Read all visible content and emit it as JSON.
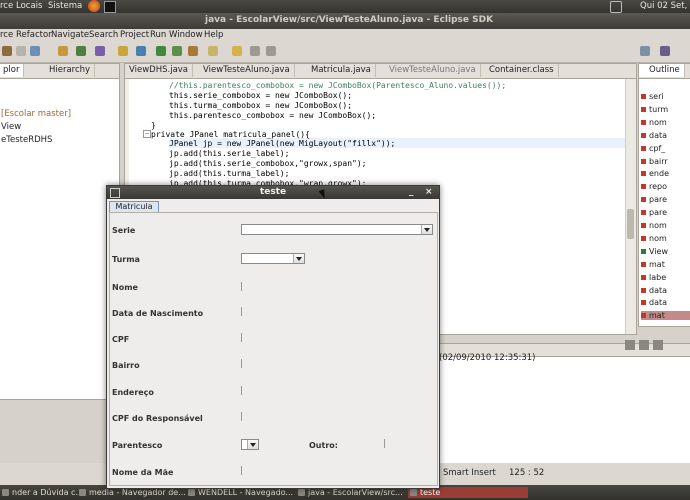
{
  "top_panel": {
    "menu_1": "rce",
    "menu_2": "Locais",
    "menu_3": "Sistema",
    "clock": "Qui 02 Set,"
  },
  "window": {
    "title": "java - EscolarView/src/ViewTesteAluno.java - Eclipse SDK"
  },
  "menu": {
    "items": [
      "rce",
      "Refactor",
      "Navigate",
      "Search",
      "Project",
      "Run",
      "Window",
      "Help"
    ]
  },
  "explorer": {
    "tabs": [
      "plor",
      "Hierarchy"
    ],
    "items": [
      "[Escolar master]",
      "View",
      "eTesteRDHS"
    ]
  },
  "editor": {
    "tabs": [
      "ViewDHS.java",
      "ViewTesteAluno.java",
      "Matricula.java",
      "ViewTesteAluno.java",
      "Container.class"
    ],
    "code_lines": [
      "//this.parentesco_combobox = new JComboBox(Parentesco_Aluno.values());",
      "this.serie_combobox = new JComboBox();",
      "this.turma_combobox = new JComboBox();",
      "this.parentesco_combobox = new JComboBox();",
      "}",
      "private JPanel matricula_panel(){",
      "JPanel jp = new JPanel(new MigLayout(\"fillx\"));",
      "jp.add(this.serie_label);",
      "jp.add(this.serie_combobox,\"growx,span\");",
      "jp.add(this.turma_label);",
      "jp.add(this.turma_combobox,\"wrap,growx\");"
    ]
  },
  "outline": {
    "tab": "Outline",
    "items": [
      "seri",
      "turm",
      "nom",
      "data",
      "cpf_",
      "bairr",
      "ende",
      "repo",
      "pare",
      "pare",
      "nom",
      "nom",
      "View",
      "mat",
      "labe",
      "data",
      "data",
      "mat"
    ]
  },
  "console": {
    "timestamp": "(02/09/2010 12:35:31)"
  },
  "status_bar": {
    "insert_mode": "Smart Insert",
    "position": "125 : 52"
  },
  "taskbar": {
    "items": [
      "nder a Dúvida c...",
      "media - Navegador de...",
      "WENDELL - Navegado...",
      "java - EscolarView/src...",
      "teste"
    ]
  },
  "dialog": {
    "title": "teste",
    "tab": "Matricula",
    "labels": {
      "serie": "Serie",
      "turma": "Turma",
      "nome": "Nome",
      "data_nasc": "Data de Nascimento",
      "cpf": "CPF",
      "bairro": "Bairro",
      "endereco": "Endereço",
      "cpf_resp": "CPF do Responsável",
      "parentesco": "Parentesco",
      "outro": "Outro:",
      "nome_mae": "Nome da Mãe"
    }
  },
  "colors": {
    "accent": "#7f0055",
    "selection_taskbar": "#9a3d34"
  }
}
